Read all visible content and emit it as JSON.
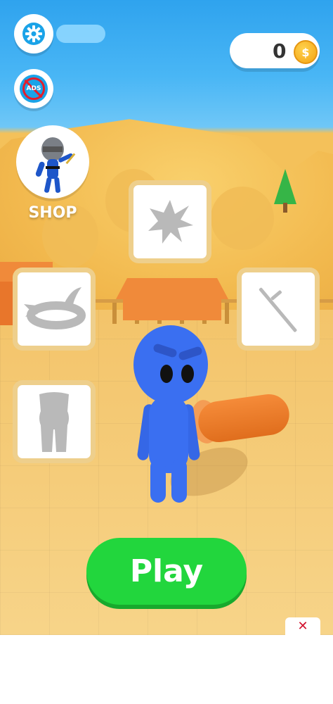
{
  "hud": {
    "coins": "0",
    "coin_icon": "coin-icon",
    "settings_icon": "gear-icon",
    "no_ads_label": "ADS"
  },
  "shop": {
    "label": "SHOP",
    "icon": "ninja-character-icon"
  },
  "slots": [
    {
      "name": "throwing-star",
      "icon": "shuriken-icon"
    },
    {
      "name": "headband",
      "icon": "headband-icon"
    },
    {
      "name": "sword",
      "icon": "katana-icon"
    },
    {
      "name": "outfit",
      "icon": "body-suit-icon"
    }
  ],
  "play": {
    "label": "Play"
  },
  "ad": {
    "close_icon": "close-icon",
    "close_symbol": "✕"
  },
  "colors": {
    "play_green": "#22d63d",
    "character_blue": "#3a6ff1",
    "sky": "#49b6f5",
    "sand": "#f4c15a",
    "close_red": "#d2122e"
  }
}
